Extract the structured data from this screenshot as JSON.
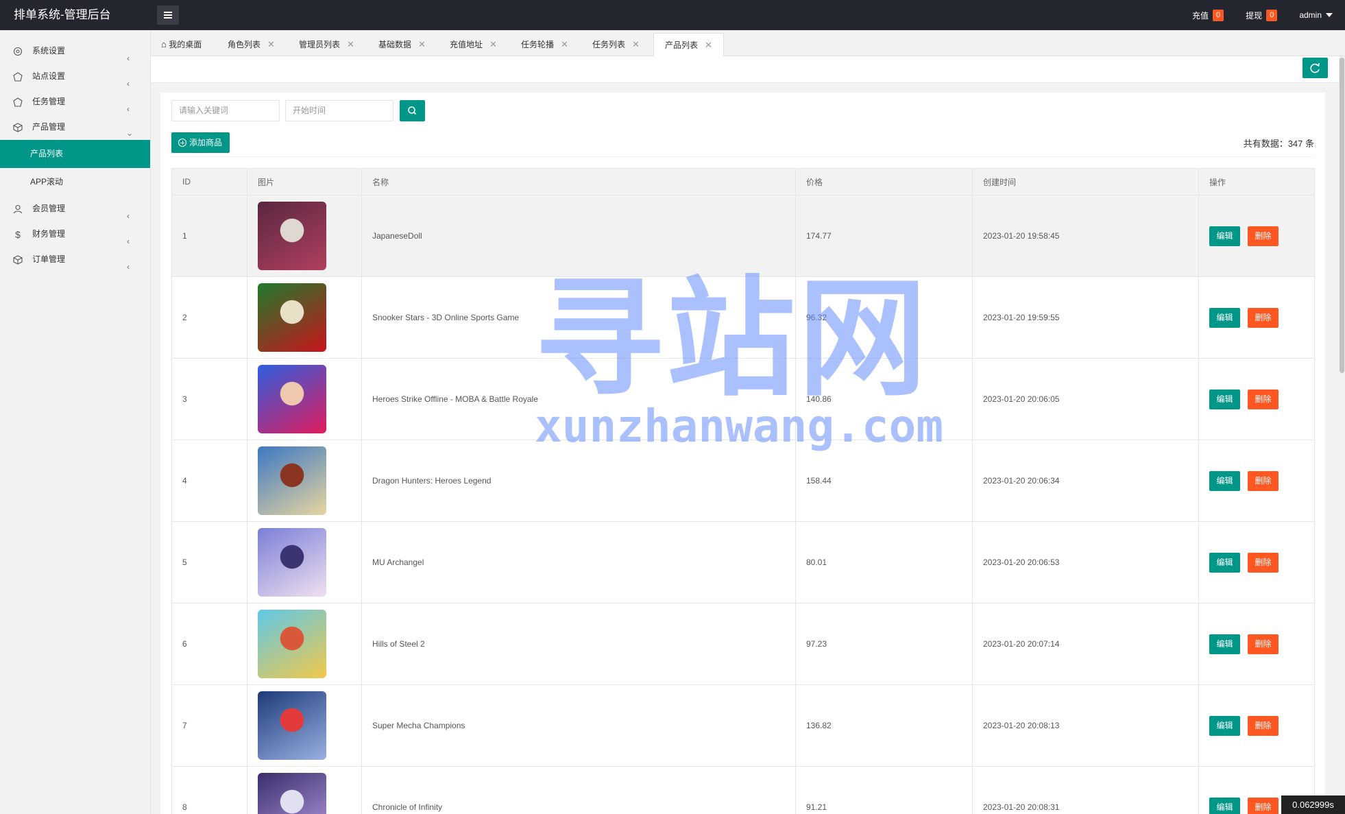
{
  "header": {
    "title": "排单系统-管理后台",
    "recharge_label": "充值",
    "recharge_count": "0",
    "withdraw_label": "提现",
    "withdraw_count": "0",
    "user": "admin"
  },
  "sidebar": {
    "items": [
      {
        "label": "系统设置",
        "icon": "gear-icon"
      },
      {
        "label": "站点设置",
        "icon": "site-icon"
      },
      {
        "label": "任务管理",
        "icon": "task-icon"
      },
      {
        "label": "产品管理",
        "icon": "box-icon"
      },
      {
        "label": "会员管理",
        "icon": "user-icon"
      },
      {
        "label": "财务管理",
        "icon": "dollar-icon"
      },
      {
        "label": "订单管理",
        "icon": "box-icon"
      }
    ],
    "subitems": [
      {
        "label": "产品列表",
        "active": true
      },
      {
        "label": "APP滚动",
        "active": false
      }
    ]
  },
  "tabs": [
    {
      "label": "我的桌面"
    },
    {
      "label": "角色列表"
    },
    {
      "label": "管理员列表"
    },
    {
      "label": "基础数据"
    },
    {
      "label": "充值地址"
    },
    {
      "label": "任务轮播"
    },
    {
      "label": "任务列表"
    },
    {
      "label": "产品列表"
    }
  ],
  "search": {
    "keyword_placeholder": "请输入关键词",
    "date_placeholder": "开始时间"
  },
  "toolbar": {
    "add_label": "添加商品",
    "total_text": "共有数据：347 条"
  },
  "table": {
    "headers": [
      "ID",
      "图片",
      "名称",
      "价格",
      "创建时间",
      "操作"
    ],
    "edit_label": "编辑",
    "delete_label": "删除",
    "rows": [
      {
        "id": "1",
        "name": "JapaneseDoll",
        "price": "174.77",
        "created": "2023-01-20 19:58:45",
        "thumb": [
          "#5a2740",
          "#b0405f",
          "#ded8d0"
        ]
      },
      {
        "id": "2",
        "name": "Snooker Stars - 3D Online Sports Game",
        "price": "96.32",
        "created": "2023-01-20 19:59:55",
        "thumb": [
          "#1f7a2c",
          "#c9151b",
          "#e9e0c8"
        ]
      },
      {
        "id": "3",
        "name": "Heroes Strike Offline - MOBA & Battle Royale",
        "price": "140.86",
        "created": "2023-01-20 20:06:05",
        "thumb": [
          "#2e5fe0",
          "#e11d5d",
          "#f0c8b0"
        ]
      },
      {
        "id": "4",
        "name": "Dragon Hunters: Heroes Legend",
        "price": "158.44",
        "created": "2023-01-20 20:06:34",
        "thumb": [
          "#3c78c2",
          "#e8d5a0",
          "#8a3422"
        ]
      },
      {
        "id": "5",
        "name": "MU Archangel",
        "price": "80.01",
        "created": "2023-01-20 20:06:53",
        "thumb": [
          "#7a7fd8",
          "#f0e0ef",
          "#3a3470"
        ]
      },
      {
        "id": "6",
        "name": "Hills of Steel 2",
        "price": "97.23",
        "created": "2023-01-20 20:07:14",
        "thumb": [
          "#5ec8e8",
          "#f2c84a",
          "#d9583a"
        ]
      },
      {
        "id": "7",
        "name": "Super Mecha Champions",
        "price": "136.82",
        "created": "2023-01-20 20:08:13",
        "thumb": [
          "#1d3b7a",
          "#9ab0e0",
          "#e33b3b"
        ]
      },
      {
        "id": "8",
        "name": "Chronicle of Infinity",
        "price": "91.21",
        "created": "2023-01-20 20:08:31",
        "thumb": [
          "#3a2e6a",
          "#b39ae0",
          "#e0e0f0"
        ]
      }
    ]
  },
  "watermark": {
    "cn": "寻站网",
    "en": "xunzhanwang.com"
  },
  "timer": "0.062999s",
  "colors": {
    "header_bg": "#23262e",
    "accent": "#009688",
    "danger": "#ff5722"
  }
}
